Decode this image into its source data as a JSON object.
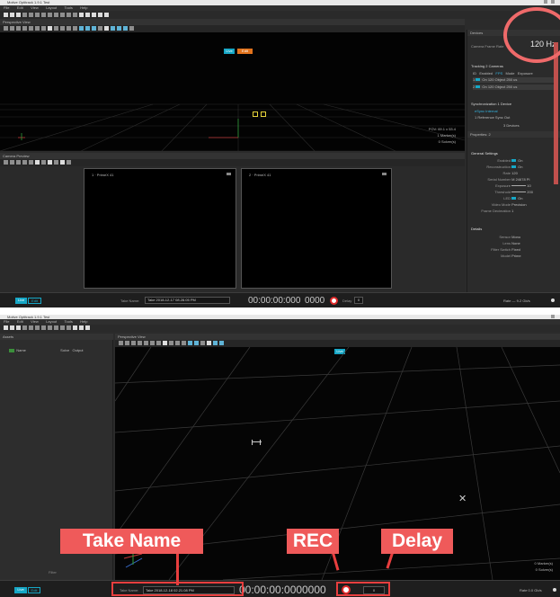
{
  "top": {
    "window_title": "Motive Optitrack 1.9.1 Test",
    "menu": [
      "File",
      "Edit",
      "View",
      "Layout",
      "Tools",
      "Help"
    ],
    "viewport_title": "Perspective View",
    "view_btn_blue": "Live",
    "view_btn_orange": "Edit",
    "overlay_lines": [
      "FOV: 69.1 x 53.4",
      "1 Marker(s)",
      "0 Solver(s)"
    ],
    "camera_preview_title": "Camera Preview",
    "cam_views": [
      {
        "title": "1 · PrimeX 41"
      },
      {
        "title": "2 · PrimeX 41"
      }
    ],
    "devices": {
      "title": "Devices",
      "rate_label": "Camera Frame Rate",
      "rate_value": "120 Hz",
      "tracking_header": "Tracking  2 Cameras",
      "table_cols": [
        "ID",
        "Enabled",
        "FPS",
        "Mode",
        "Exposure"
      ],
      "table_rows": [
        [
          "1",
          "On",
          "120",
          "Object",
          "250 us"
        ],
        [
          "2",
          "On",
          "120",
          "Object",
          "250 us"
        ]
      ],
      "sync_header": "Synchronization  1 Device",
      "sync_rows": [
        "eSync   Internal",
        "1 Reference   Sync Out"
      ],
      "devices_count": "3 Devices"
    },
    "properties": {
      "title": "Properties: 2",
      "general_header": "General Settings",
      "rows": [
        {
          "label": "Enabled",
          "value": "On"
        },
        {
          "label": "Reconstruction",
          "value": "On"
        },
        {
          "label": "Rate",
          "value": "120"
        },
        {
          "label": "Serial Number",
          "value": "M 24678 Pl"
        },
        {
          "label": "Exposure",
          "value": "10"
        },
        {
          "label": "Threshold",
          "value": "200"
        },
        {
          "label": "LED",
          "value": "On"
        },
        {
          "label": "Video Mode",
          "value": "Precision"
        },
        {
          "label": "Frame Decimation",
          "value": "1"
        }
      ],
      "details_header": "Details",
      "detail_rows": [
        {
          "label": "Sensor",
          "value": "Mono"
        },
        {
          "label": "Lens",
          "value": "None"
        },
        {
          "label": "Filter Switch",
          "value": "Fixed"
        },
        {
          "label": "Model",
          "value": "Prime"
        }
      ]
    },
    "timeline": {
      "live_label": "Live",
      "edit_label": "Edit",
      "take_name_label": "Take Name:",
      "take_name_value": "Take 2018-12-17 08.28.05 PM",
      "timecode": "00:00:00:000",
      "frame": "0000",
      "delay_label": "Delay",
      "delay_value": "0",
      "rate_readout": "Rate  —  9.2 Gb/s"
    }
  },
  "bottom": {
    "window_title": "Motive Optitrack 1.9.1 Test",
    "menu": [
      "File",
      "Edit",
      "View",
      "Layout",
      "Tools",
      "Help"
    ],
    "assets_title": "Assets",
    "assets_cols": [
      "Name",
      "Solve",
      "Output"
    ],
    "viewport_title": "Perspective View",
    "viewport_tag": "Live",
    "status_lines": [
      "0 Marker(s)",
      "0 Solver(s)"
    ],
    "bottom_label": "Filter",
    "timeline": {
      "live_label": "Live",
      "edit_label": "Edit",
      "take_name_label": "Take Name:",
      "take_name_value": "Take 2018-12-18 02.21.08 PM",
      "timecode": "00:00:00:000",
      "frame": "0000",
      "delay_value": "0",
      "rate_readout": "Rate  0.0 Gb/s"
    }
  },
  "annotations": {
    "take_name": "Take Name",
    "rec": "REC",
    "delay": "Delay"
  },
  "colors": {
    "accent_blue": "#16a7c6",
    "accent_orange": "#e2731c",
    "annotation_red": "#e83e3e"
  }
}
